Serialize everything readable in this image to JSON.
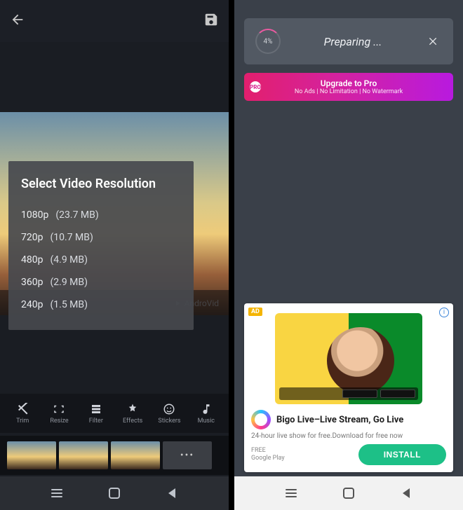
{
  "left": {
    "watermark": "AndroVid",
    "dialog": {
      "title": "Select Video Resolution",
      "options": [
        {
          "label": "1080p",
          "size": "(23.7 MB)"
        },
        {
          "label": "720p",
          "size": "(10.7 MB)"
        },
        {
          "label": "480p",
          "size": "(4.9 MB)"
        },
        {
          "label": "360p",
          "size": "(2.9 MB)"
        },
        {
          "label": "240p",
          "size": "(1.5 MB)"
        }
      ]
    },
    "tools": [
      {
        "label": "Trim"
      },
      {
        "label": "Resize"
      },
      {
        "label": "Filter"
      },
      {
        "label": "Effects"
      },
      {
        "label": "Stickers"
      },
      {
        "label": "Music"
      }
    ]
  },
  "right": {
    "progress": {
      "percent": "4%",
      "status": "Preparing ..."
    },
    "upgrade": {
      "title": "Upgrade to Pro",
      "subtitle": "No Ads | No Limitation | No Watermark",
      "badge": "PRO"
    },
    "ad": {
      "tag": "AD",
      "title": "Bigo Live–Live Stream, Go Live",
      "description": "24-hour live show for free.Download for free now",
      "meta1": "FREE",
      "meta2": "Google Play",
      "cta": "INSTALL"
    }
  }
}
